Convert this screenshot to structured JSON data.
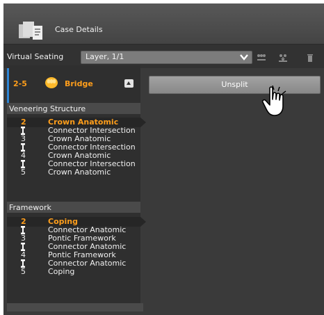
{
  "header": {
    "title": "Case Details",
    "icon": "case-details-icon"
  },
  "toolbar": {
    "virtual_seating_label": "Virtual Seating",
    "layer_select_value": "Layer, 1/1",
    "icons": [
      "connector-icon",
      "download-teeth-icon",
      "trash-icon"
    ]
  },
  "bridge": {
    "range": "2-5",
    "label": "Bridge",
    "icon": "bridge-tooth-icon"
  },
  "veneering": {
    "title": "Veneering Structure",
    "rows": [
      {
        "num": "2",
        "name": "Crown Anatomic",
        "selected": true
      },
      {
        "num": "",
        "name": "Connector Intersection",
        "connector": true
      },
      {
        "num": "3",
        "name": "Crown Anatomic"
      },
      {
        "num": "",
        "name": "Connector Intersection",
        "connector": true
      },
      {
        "num": "4",
        "name": "Crown Anatomic"
      },
      {
        "num": "",
        "name": "Connector Intersection",
        "connector": true
      },
      {
        "num": "5",
        "name": "Crown Anatomic"
      }
    ]
  },
  "framework": {
    "title": "Framework",
    "rows": [
      {
        "num": "2",
        "name": "Coping",
        "selected": true
      },
      {
        "num": "",
        "name": "Connector Anatomic",
        "connector": true
      },
      {
        "num": "3",
        "name": "Pontic Framework"
      },
      {
        "num": "",
        "name": "Connector Anatomic",
        "connector": true
      },
      {
        "num": "4",
        "name": "Pontic Framework"
      },
      {
        "num": "",
        "name": "Connector Anatomic",
        "connector": true
      },
      {
        "num": "5",
        "name": "Coping"
      }
    ]
  },
  "unsplit_label": "Unsplit",
  "colors": {
    "accent": "#ff9e1b",
    "selection_blue": "#2e86d6",
    "panel": "#3a3a3a"
  }
}
